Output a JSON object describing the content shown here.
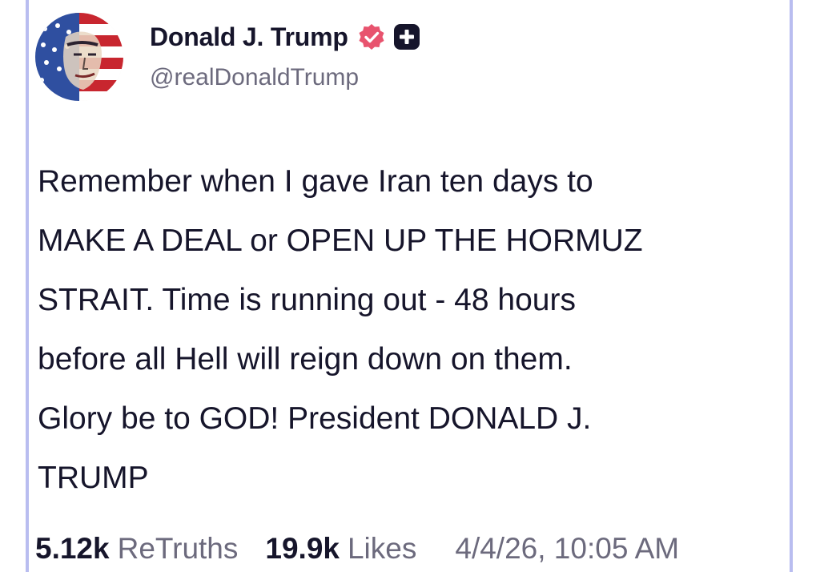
{
  "post": {
    "author": {
      "display_name": "Donald J. Trump",
      "handle": "@realDonaldTrump",
      "avatar_icon": "flag-portrait-avatar",
      "verified_icon": "verified-badge-icon",
      "plus_icon": "plus-badge-icon"
    },
    "text": "Remember when I gave Iran ten days to\nMAKE A DEAL or OPEN UP THE HORMUZ\nSTRAIT. Time is running out - 48 hours\nbefore all Hell will reign down on them.\nGlory be to GOD! President DONALD J.\nTRUMP",
    "stats": {
      "retruths_count": "5.12k",
      "retruths_label": "ReTruths",
      "likes_count": "19.9k",
      "likes_label": "Likes",
      "timestamp": "4/4/26, 10:05 AM"
    }
  },
  "colors": {
    "frame_border": "#b9bdf0",
    "verified": "#e8536e",
    "text_primary": "#16152b",
    "text_secondary": "#6c6a7d"
  }
}
